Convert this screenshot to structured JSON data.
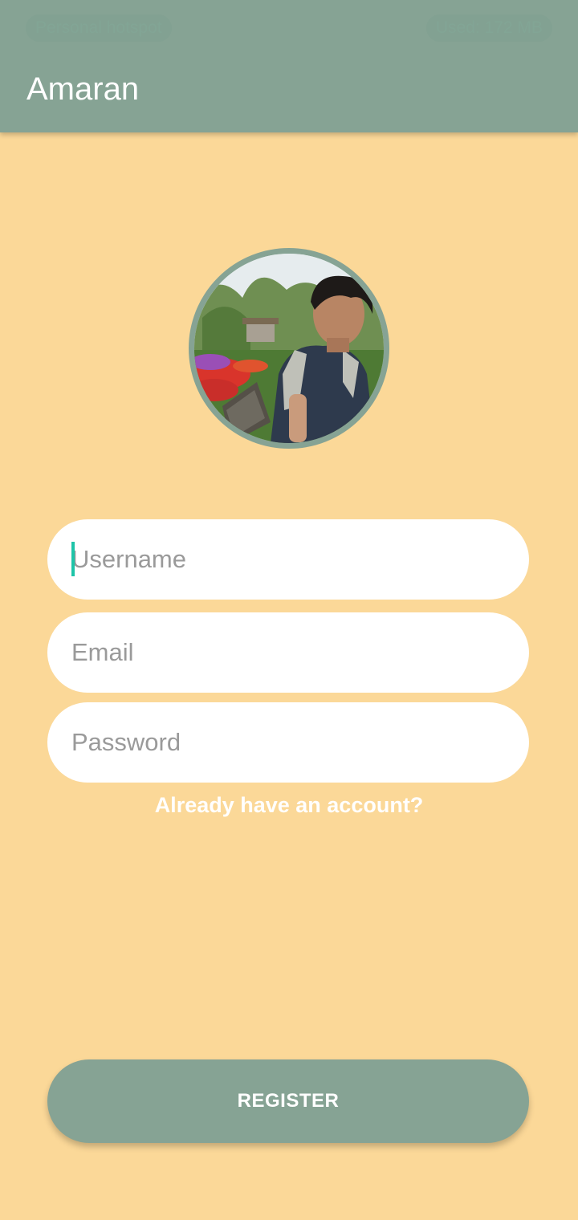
{
  "status_bar": {
    "left_text": "Personal hotspot",
    "right_text": "Used: 172 MB"
  },
  "app_bar": {
    "title": "Amaran"
  },
  "colors": {
    "background": "#FBD898",
    "primary": "#86A394",
    "cursor": "#1EC4A8"
  },
  "form": {
    "username_placeholder": "Username",
    "email_placeholder": "Email",
    "password_placeholder": "Password",
    "login_link": "Already have an account?",
    "register_label": "REGISTER"
  }
}
